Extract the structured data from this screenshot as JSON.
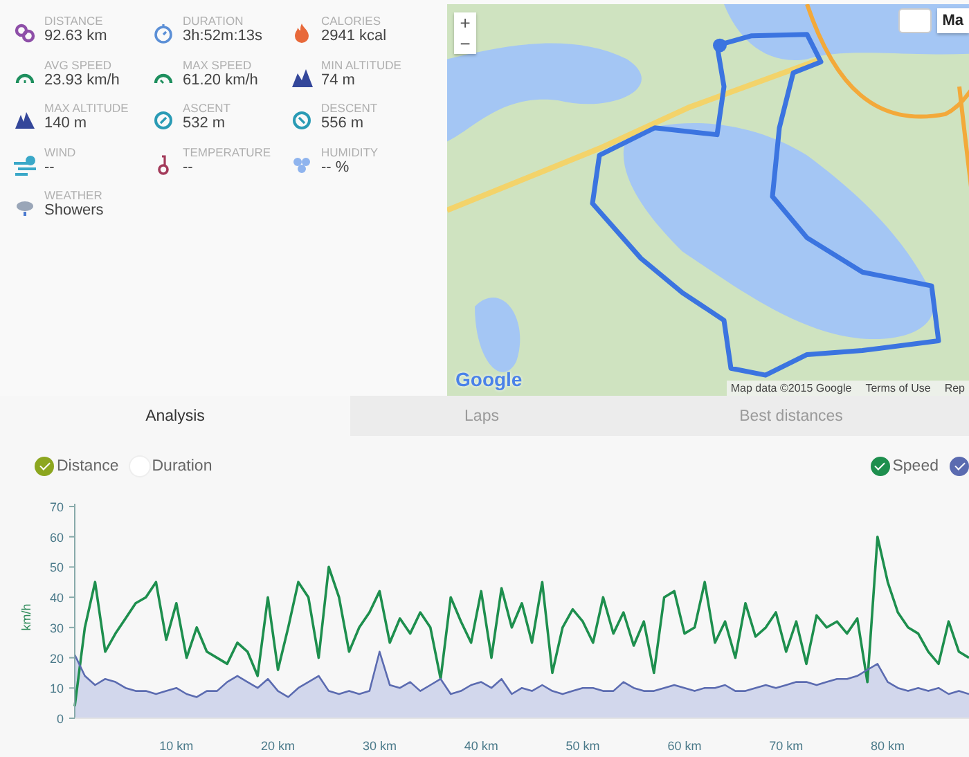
{
  "stats": [
    {
      "kind": "distance",
      "label": "DISTANCE",
      "value": "92.63 km"
    },
    {
      "kind": "duration",
      "label": "DURATION",
      "value": "3h:52m:13s"
    },
    {
      "kind": "calories",
      "label": "CALORIES",
      "value": "2941 kcal"
    },
    {
      "kind": "avg_speed",
      "label": "AVG SPEED",
      "value": "23.93 km/h"
    },
    {
      "kind": "max_speed",
      "label": "MAX SPEED",
      "value": "61.20 km/h"
    },
    {
      "kind": "min_altitude",
      "label": "MIN ALTITUDE",
      "value": "74 m"
    },
    {
      "kind": "max_altitude",
      "label": "MAX ALTITUDE",
      "value": "140 m"
    },
    {
      "kind": "ascent",
      "label": "ASCENT",
      "value": "532 m"
    },
    {
      "kind": "descent",
      "label": "DESCENT",
      "value": "556 m"
    },
    {
      "kind": "wind",
      "label": "WIND",
      "value": "--"
    },
    {
      "kind": "temperature",
      "label": "TEMPERATURE",
      "value": "--"
    },
    {
      "kind": "humidity",
      "label": "HUMIDITY",
      "value": "-- %"
    },
    {
      "kind": "weather",
      "label": "WEATHER",
      "value": "Showers"
    }
  ],
  "map": {
    "kind": "picture",
    "zoom_in": "+",
    "zoom_out": "−",
    "type_button": "Ma",
    "logo": "Google",
    "attribution": "Map data ©2015 Google",
    "terms": "Terms of Use",
    "report": "Rep"
  },
  "tabs": [
    {
      "label": "Analysis",
      "selected": true
    },
    {
      "label": "Laps",
      "selected": false
    },
    {
      "label": "Best distances",
      "selected": false
    }
  ],
  "axis_toggle": [
    {
      "label": "Distance",
      "selected": true
    },
    {
      "label": "Duration",
      "selected": false
    }
  ],
  "legend": [
    {
      "checked": true
    },
    {
      "checked": true
    }
  ],
  "chart_data": {
    "type": "line",
    "ylabel": "km/h",
    "ylim": [
      0,
      70
    ],
    "yticks": [
      0,
      10,
      20,
      30,
      40,
      50,
      60,
      70
    ],
    "xlim": [
      0,
      88
    ],
    "xticks": [
      {
        "value": 10,
        "label": "10 km"
      },
      {
        "value": 20,
        "label": "20 km"
      },
      {
        "value": 30,
        "label": "30 km"
      },
      {
        "value": 40,
        "label": "40 km"
      },
      {
        "value": 50,
        "label": "50 km"
      },
      {
        "value": 60,
        "label": "60 km"
      },
      {
        "value": 70,
        "label": "70 km"
      },
      {
        "value": 80,
        "label": "80 km"
      }
    ],
    "x": [
      0,
      1,
      2,
      3,
      4,
      5,
      6,
      7,
      8,
      9,
      10,
      11,
      12,
      13,
      14,
      15,
      16,
      17,
      18,
      19,
      20,
      21,
      22,
      23,
      24,
      25,
      26,
      27,
      28,
      29,
      30,
      31,
      32,
      33,
      34,
      35,
      36,
      37,
      38,
      39,
      40,
      41,
      42,
      43,
      44,
      45,
      46,
      47,
      48,
      49,
      50,
      51,
      52,
      53,
      54,
      55,
      56,
      57,
      58,
      59,
      60,
      61,
      62,
      63,
      64,
      65,
      66,
      67,
      68,
      69,
      70,
      71,
      72,
      73,
      74,
      75,
      76,
      77,
      78,
      79,
      80,
      81,
      82,
      83,
      84,
      85,
      86,
      87,
      88
    ],
    "series": [
      {
        "name": "Speed",
        "color": "#1e8f4e",
        "values": [
          4,
          30,
          45,
          22,
          28,
          33,
          38,
          40,
          45,
          26,
          38,
          20,
          30,
          22,
          20,
          18,
          25,
          22,
          14,
          40,
          16,
          30,
          45,
          40,
          20,
          50,
          40,
          22,
          30,
          35,
          42,
          25,
          33,
          28,
          35,
          30,
          13,
          40,
          32,
          25,
          42,
          20,
          43,
          30,
          38,
          25,
          45,
          15,
          30,
          36,
          32,
          25,
          40,
          28,
          35,
          24,
          32,
          15,
          40,
          42,
          28,
          30,
          45,
          25,
          32,
          20,
          38,
          27,
          30,
          35,
          22,
          32,
          18,
          34,
          30,
          32,
          28,
          33,
          12,
          60,
          45,
          35,
          30,
          28,
          22,
          18,
          32,
          22,
          20
        ]
      },
      {
        "color": "#5b6bb0",
        "values": [
          21,
          14,
          11,
          13,
          12,
          10,
          9,
          9,
          8,
          9,
          10,
          8,
          7,
          9,
          9,
          12,
          14,
          12,
          10,
          13,
          9,
          7,
          10,
          12,
          14,
          9,
          8,
          9,
          8,
          9,
          22,
          11,
          10,
          12,
          9,
          11,
          13,
          8,
          9,
          11,
          12,
          10,
          13,
          8,
          10,
          9,
          11,
          9,
          8,
          9,
          10,
          10,
          9,
          9,
          12,
          10,
          9,
          9,
          10,
          11,
          10,
          9,
          10,
          10,
          11,
          9,
          9,
          10,
          11,
          10,
          11,
          12,
          12,
          11,
          12,
          13,
          13,
          14,
          16,
          18,
          12,
          10,
          9,
          10,
          9,
          10,
          8,
          9,
          8
        ]
      }
    ]
  }
}
